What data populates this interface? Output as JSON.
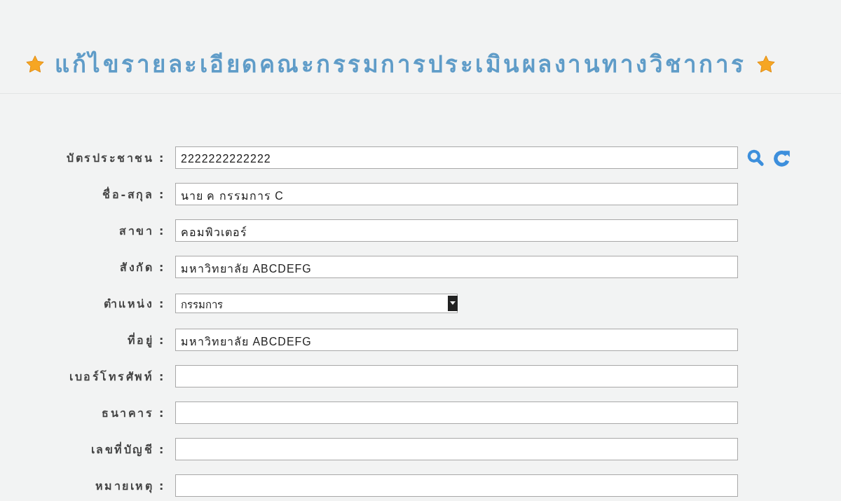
{
  "page": {
    "title": "แก้ไขรายละเอียดคณะกรรมการประเมินผลงานทางวิชาการ"
  },
  "fields": [
    {
      "label": "บัตรประชาชน :",
      "value": "2222222222222",
      "kind": "lookup"
    },
    {
      "label": "ชื่อ-สกุล :",
      "value": "นาย ค กรรมการ C",
      "kind": "text"
    },
    {
      "label": "สาขา :",
      "value": "คอมพิวเตอร์",
      "kind": "text"
    },
    {
      "label": "สังกัด :",
      "value": "มหาวิทยาลัย ABCDEFG",
      "kind": "text"
    },
    {
      "label": "ตำแหน่ง :",
      "value": "กรรมการ",
      "kind": "select"
    },
    {
      "label": "ที่อยู่ :",
      "value": "มหาวิทยาลัย ABCDEFG",
      "kind": "text"
    },
    {
      "label": "เบอร์โทรศัพท์ :",
      "kind": "text"
    },
    {
      "label": "ธนาคาร :",
      "kind": "text"
    },
    {
      "label": "เลขที่บัญชี :",
      "kind": "text"
    },
    {
      "label": "หมายเหตุ :",
      "kind": "text"
    }
  ]
}
